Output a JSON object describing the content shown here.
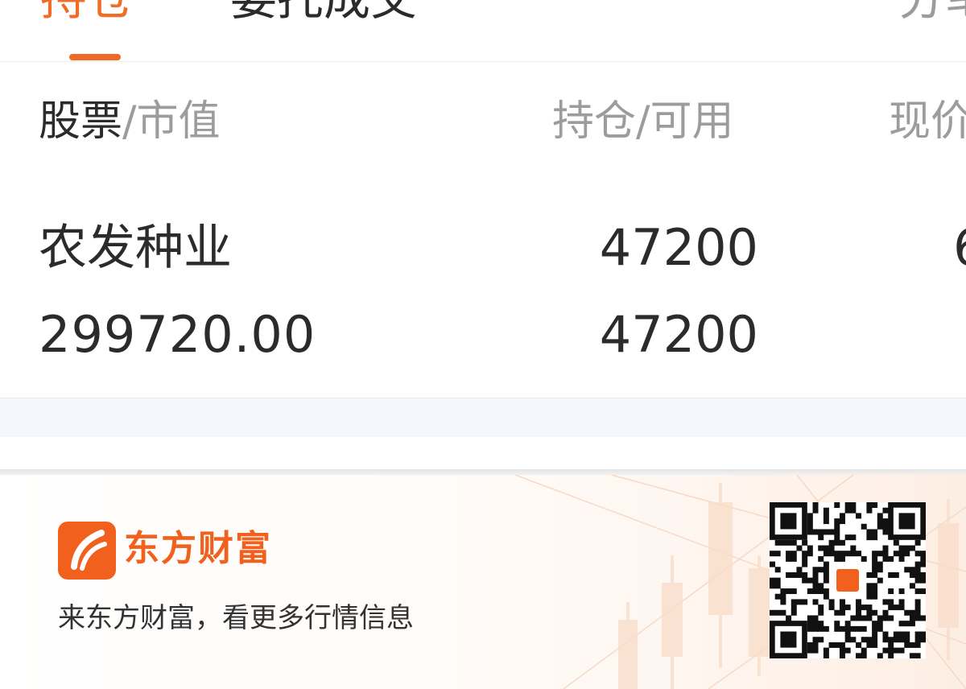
{
  "tabs": {
    "positions": "持仓",
    "orders": "委托成交",
    "more": "分笔"
  },
  "columns": {
    "stock_main": "股票",
    "stock_sub": "/市值",
    "hold": "持仓/可用",
    "price": "现价"
  },
  "holding": {
    "name": "农发种业",
    "market_value": "299720.00",
    "position": "47200",
    "available": "47200",
    "price_partial": "6"
  },
  "footer": {
    "brand": "东方财富",
    "slogan": "来东方财富，看更多行情信息"
  },
  "colors": {
    "accent": "#f06c28",
    "brand": "#f2601d",
    "muted_text": "#9c9c9c",
    "text": "#2b2b2b"
  },
  "icons": {
    "logo": "eastmoney-logo-icon",
    "qr": "qr-code"
  }
}
